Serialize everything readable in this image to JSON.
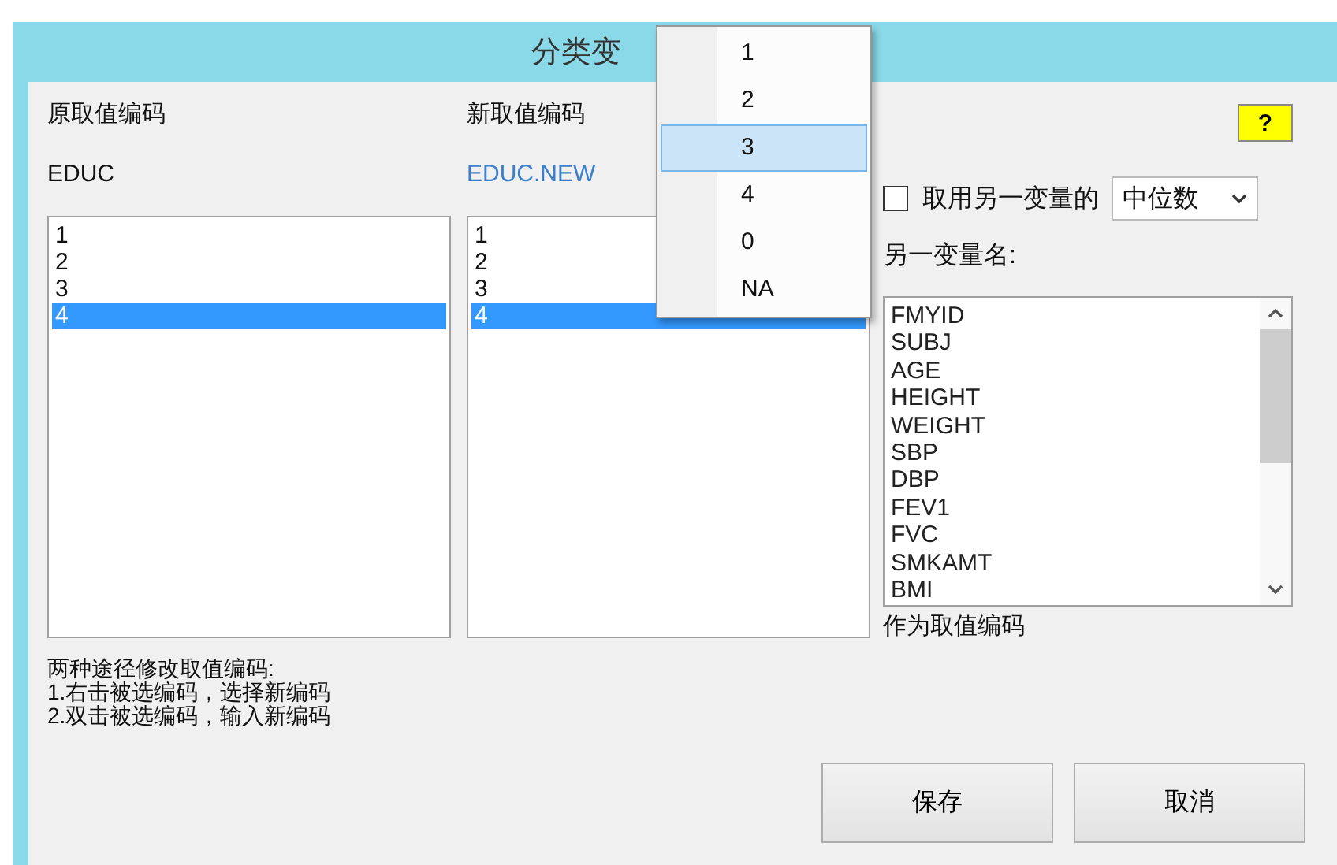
{
  "window": {
    "title": "分类变"
  },
  "original": {
    "label": "原取值编码",
    "variable": "EDUC",
    "codes": [
      {
        "text": "1",
        "selected": false
      },
      {
        "text": "2",
        "selected": false
      },
      {
        "text": "3",
        "selected": false
      },
      {
        "text": "4",
        "selected": true
      }
    ]
  },
  "new": {
    "label": "新取值编码",
    "variable": "EDUC.NEW",
    "codes": [
      {
        "text": "1",
        "selected": false
      },
      {
        "text": "2",
        "selected": false
      },
      {
        "text": "3",
        "selected": false
      },
      {
        "text": "4",
        "selected": true
      }
    ]
  },
  "help_button": "?",
  "use_other": {
    "label": "取用另一变量的",
    "checked": false,
    "statistic": "中位数"
  },
  "other_variable": {
    "label": "另一变量名:",
    "items": [
      "FMYID",
      "SUBJ",
      "AGE",
      "HEIGHT",
      "WEIGHT",
      "SBP",
      "DBP",
      "FEV1",
      "FVC",
      "SMKAMT",
      "BMI"
    ],
    "caption": "作为取值编码"
  },
  "instructions": [
    "两种途径修改取值编码:",
    "1.右击被选编码，选择新编码",
    "2.双击被选编码，输入新编码"
  ],
  "buttons": [
    "保存",
    "取消"
  ],
  "context_menu": [
    {
      "text": "1",
      "selected": false
    },
    {
      "text": "2",
      "selected": false
    },
    {
      "text": "3",
      "selected": true
    },
    {
      "text": "4",
      "selected": false
    },
    {
      "text": "0",
      "selected": false
    },
    {
      "text": "NA",
      "selected": false
    }
  ]
}
